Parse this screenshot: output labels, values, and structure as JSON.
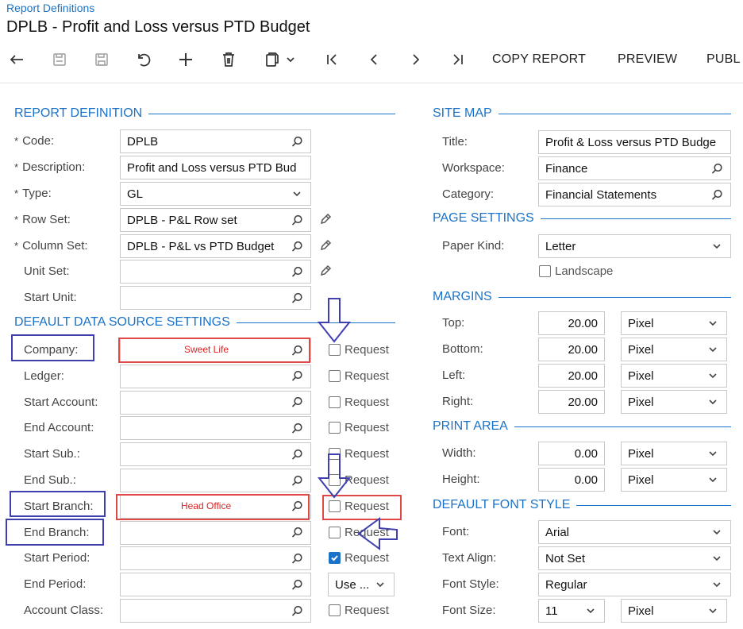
{
  "breadcrumb": "Report Definitions",
  "page_title": "DPLB - Profit and Loss versus PTD Budget",
  "toolbar": {
    "copy_report": "COPY REPORT",
    "preview": "PREVIEW",
    "publish_partial": "PUBL"
  },
  "report_definition": {
    "header": "REPORT DEFINITION",
    "code_label": "Code:",
    "code_value": "DPLB",
    "description_label": "Description:",
    "description_value": "Profit and Loss versus PTD Bud",
    "type_label": "Type:",
    "type_value": "GL",
    "row_set_label": "Row Set:",
    "row_set_value": "DPLB - P&L Row set",
    "column_set_label": "Column Set:",
    "column_set_value": "DPLB - P&L vs PTD Budget",
    "unit_set_label": "Unit Set:",
    "unit_set_value": "",
    "start_unit_label": "Start Unit:",
    "start_unit_value": ""
  },
  "default_data_source": {
    "header": "DEFAULT DATA SOURCE SETTINGS",
    "request_label": "Request",
    "use_label": "Use ...",
    "rows": [
      {
        "label": "Company:",
        "value": "",
        "note": "Sweet Life",
        "request": false
      },
      {
        "label": "Ledger:",
        "value": "",
        "request": false
      },
      {
        "label": "Start Account:",
        "value": "",
        "request": false
      },
      {
        "label": "End Account:",
        "value": "",
        "request": false
      },
      {
        "label": "Start Sub.:",
        "value": "",
        "request": false
      },
      {
        "label": "End Sub.:",
        "value": "",
        "request": false
      },
      {
        "label": "Start Branch:",
        "value": "",
        "note": "Head Office",
        "request": false
      },
      {
        "label": "End Branch:",
        "value": "",
        "request": false
      },
      {
        "label": "Start Period:",
        "value": "",
        "request": true
      },
      {
        "label": "End Period:",
        "value": ""
      },
      {
        "label": "Account Class:",
        "value": "",
        "request": false
      }
    ]
  },
  "site_map": {
    "header": "SITE MAP",
    "title_label": "Title:",
    "title_value": "Profit & Loss versus PTD Budge",
    "workspace_label": "Workspace:",
    "workspace_value": "Finance",
    "category_label": "Category:",
    "category_value": "Financial Statements"
  },
  "page_settings": {
    "header": "PAGE SETTINGS",
    "paper_kind_label": "Paper Kind:",
    "paper_kind_value": "Letter",
    "landscape_label": "Landscape"
  },
  "margins": {
    "header": "MARGINS",
    "rows": [
      {
        "label": "Top:",
        "value": "20.00",
        "unit": "Pixel"
      },
      {
        "label": "Bottom:",
        "value": "20.00",
        "unit": "Pixel"
      },
      {
        "label": "Left:",
        "value": "20.00",
        "unit": "Pixel"
      },
      {
        "label": "Right:",
        "value": "20.00",
        "unit": "Pixel"
      }
    ]
  },
  "print_area": {
    "header": "PRINT AREA",
    "rows": [
      {
        "label": "Width:",
        "value": "0.00",
        "unit": "Pixel"
      },
      {
        "label": "Height:",
        "value": "0.00",
        "unit": "Pixel"
      }
    ]
  },
  "default_font_style": {
    "header": "DEFAULT FONT STYLE",
    "font_label": "Font:",
    "font_value": "Arial",
    "text_align_label": "Text Align:",
    "text_align_value": "Not Set",
    "font_style_label": "Font Style:",
    "font_style_value": "Regular",
    "font_size_label": "Font Size:",
    "font_size_value": "11",
    "font_size_unit": "Pixel"
  },
  "colors": {
    "accent": "#1a73c8",
    "annotation_red": "#e04848",
    "annotation_blue": "#3f3fb0"
  }
}
